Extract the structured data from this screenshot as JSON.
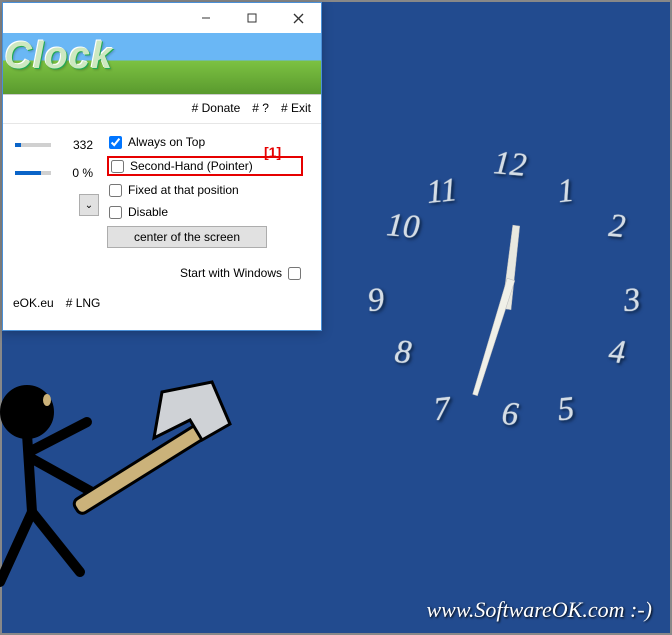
{
  "window": {
    "banner_title": "ro Clock",
    "toolbar": {
      "donate": "# Donate",
      "help": "# ?",
      "exit": "# Exit"
    },
    "sliders": [
      {
        "value": "332"
      },
      {
        "value": "0 %"
      }
    ],
    "checks": {
      "always_on_top": {
        "label": "Always on Top",
        "checked": true
      },
      "second_hand": {
        "label": "Second-Hand (Pointer)",
        "checked": false
      },
      "fixed_pos": {
        "label": "Fixed at that position",
        "checked": false
      },
      "disable": {
        "label": "Disable",
        "checked": false
      }
    },
    "center_btn": "center of the screen",
    "start_with_windows": {
      "label": "Start with Windows",
      "checked": false
    },
    "footer": {
      "eOK": "eOK.eu",
      "lng": "# LNG"
    },
    "annotation": "[1]"
  },
  "clock_numbers": [
    "12",
    "1",
    "2",
    "3",
    "4",
    "5",
    "6",
    "7",
    "8",
    "9",
    "10",
    "11"
  ],
  "watermark": "www.SoftwareOK.com :-)"
}
